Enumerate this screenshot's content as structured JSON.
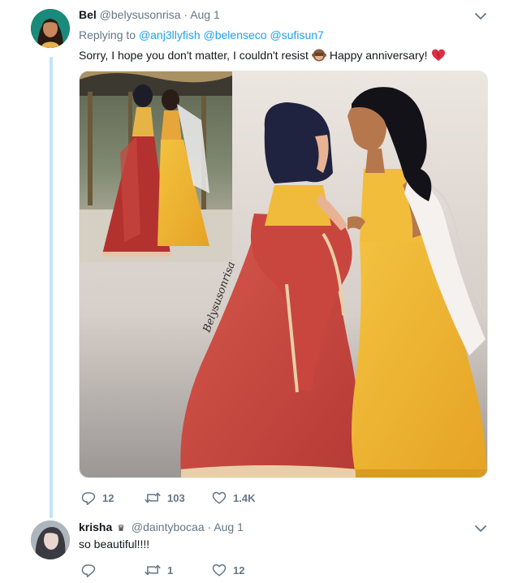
{
  "tweet": {
    "name": "Bel",
    "handle": "@belysusonrisa",
    "separator": "·",
    "time": "Aug 1",
    "replying_label": "Replying to",
    "mentions": [
      "@anj3llyfish",
      "@belenseco",
      "@sufisun7"
    ],
    "text_before_emoji": "Sorry, I hope you don't matter, I couldn't resist",
    "text_after_emoji": "Happy anniversary!",
    "emoji_names": [
      "see-no-evil-monkey-emoji",
      "heart-emoji"
    ],
    "media_signature": "Belysusonrisa",
    "stats": {
      "replies": "12",
      "retweets": "103",
      "likes": "1.4K"
    }
  },
  "reply": {
    "name": "krisha",
    "badge": "♛",
    "handle": "@daintybocaa",
    "separator": "·",
    "time": "Aug 1",
    "text": "so beautiful!!!!",
    "stats": {
      "replies": "",
      "retweets": "1",
      "likes": "12"
    }
  },
  "colors": {
    "accent": "#1da1f2",
    "muted": "#657786",
    "thread_line": "#c4e3f7",
    "heart": "#e0245e"
  },
  "icons": [
    "reply-icon",
    "retweet-icon",
    "like-icon",
    "chevron-down-icon"
  ]
}
